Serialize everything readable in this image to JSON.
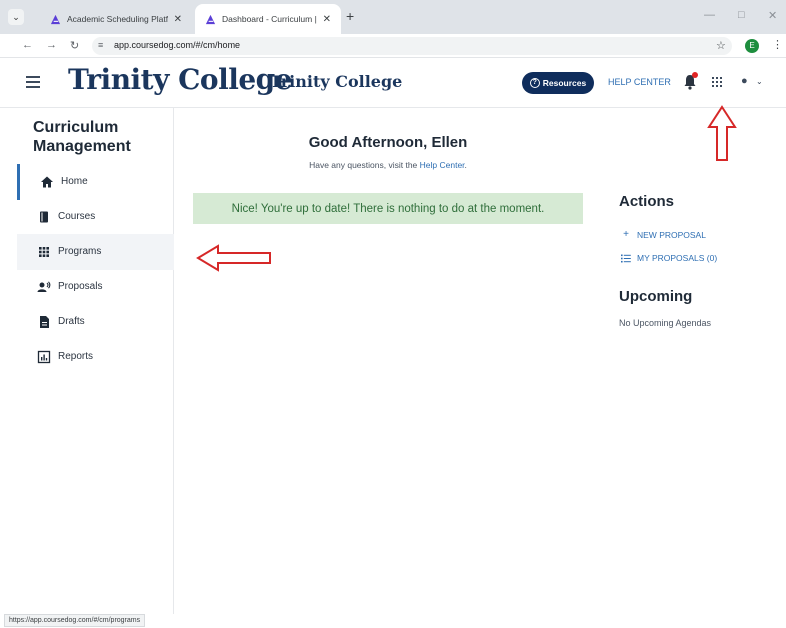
{
  "browser": {
    "tabs": [
      {
        "title": "Academic Scheduling Platform"
      },
      {
        "title": "Dashboard - Curriculum | Cours"
      }
    ],
    "new_tab": "+",
    "url": "app.coursedog.com/#/cm/home",
    "profile_initial": "E",
    "status_url": "https://app.coursedog.com/#/cm/programs"
  },
  "header": {
    "logo_text": "Trinity College",
    "institution": "Trinity College",
    "resources_label": "Resources",
    "help_center_label": "HELP CENTER"
  },
  "sidebar": {
    "title": "Curriculum Management",
    "items": [
      {
        "label": "Home",
        "icon": "home-icon"
      },
      {
        "label": "Courses",
        "icon": "book-icon"
      },
      {
        "label": "Programs",
        "icon": "grid-icon"
      },
      {
        "label": "Proposals",
        "icon": "proposal-icon"
      },
      {
        "label": "Drafts",
        "icon": "document-icon"
      },
      {
        "label": "Reports",
        "icon": "chart-icon"
      }
    ]
  },
  "main": {
    "greeting": "Good Afternoon, Ellen",
    "subtitle_prefix": "Have any questions, visit the ",
    "subtitle_link": "Help Center",
    "subtitle_suffix": ".",
    "banner": "Nice! You're up to date! There is nothing to do at the moment."
  },
  "actions": {
    "title": "Actions",
    "new_proposal": "NEW PROPOSAL",
    "my_proposals": "MY PROPOSALS (0)"
  },
  "upcoming": {
    "title": "Upcoming",
    "empty": "No Upcoming Agendas"
  },
  "colors": {
    "brand_navy": "#1b365d",
    "link_blue": "#2f6fb3",
    "banner_green": "#d6ead4",
    "annotation_red": "#d62828"
  }
}
